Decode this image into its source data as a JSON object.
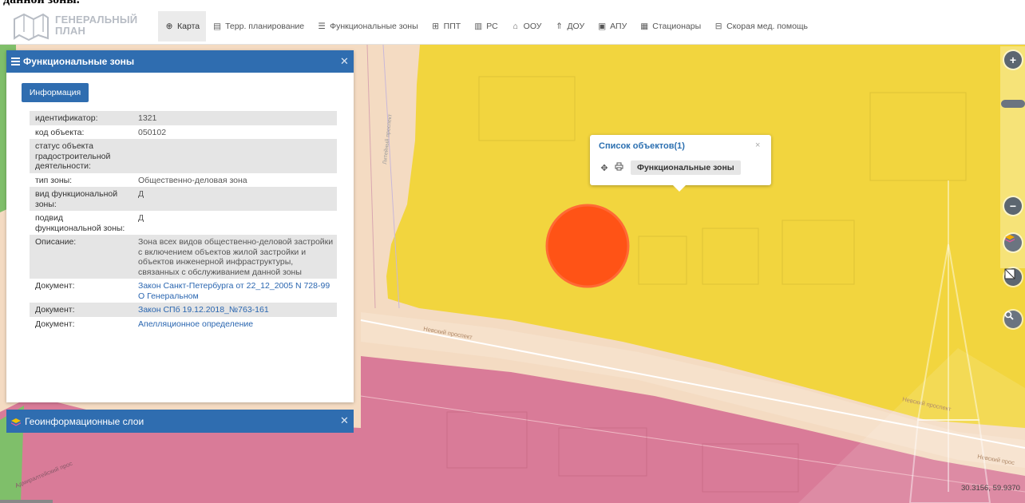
{
  "top_strip_text": "данной зоны.",
  "logo": {
    "line1": "ГЕНЕРАЛЬНЫЙ",
    "line2": "ПЛАН"
  },
  "nav": [
    {
      "label": "Карта",
      "icon": "globe-icon",
      "active": true
    },
    {
      "label": "Терр. планирование",
      "icon": "document-icon",
      "active": false
    },
    {
      "label": "Функциональные зоны",
      "icon": "list-icon",
      "active": false
    },
    {
      "label": "ППТ",
      "icon": "grid-icon",
      "active": false
    },
    {
      "label": "РС",
      "icon": "building-icon",
      "active": false
    },
    {
      "label": "ООУ",
      "icon": "school-icon",
      "active": false
    },
    {
      "label": "ДОУ",
      "icon": "kindergarten-icon",
      "active": false
    },
    {
      "label": "АПУ",
      "icon": "image-icon",
      "active": false
    },
    {
      "label": "Стационары",
      "icon": "hospital-icon",
      "active": false
    },
    {
      "label": "Скорая мед. помощь",
      "icon": "ambulance-icon",
      "active": false
    }
  ],
  "panel": {
    "title": "Функциональные зоны",
    "info_button": "Информация",
    "rows": [
      {
        "key": "идентификатор:",
        "value": "1321",
        "link": false,
        "shade": true
      },
      {
        "key": "код объекта:",
        "value": "050102",
        "link": false,
        "shade": false
      },
      {
        "key": "статус объекта градостроительной деятельности:",
        "value": "",
        "link": false,
        "shade": true
      },
      {
        "key": "тип зоны:",
        "value": "Общественно-деловая зона",
        "link": false,
        "shade": false
      },
      {
        "key": "вид функциональной зоны:",
        "value": "Д",
        "link": false,
        "shade": true
      },
      {
        "key": "подвид функциональной зоны:",
        "value": "Д",
        "link": false,
        "shade": false
      },
      {
        "key": "Описание:",
        "value": "Зона всех видов общественно-деловой застройки с включением объектов жилой застройки и объектов инженерной инфраструктуры, связанных с обслуживанием данной зоны",
        "link": false,
        "shade": true
      },
      {
        "key": "Документ:",
        "value": "Закон Санкт-Петербурга от 22_12_2005 N 728-99 О Генеральном",
        "link": true,
        "shade": false
      },
      {
        "key": "Документ:",
        "value": "Закон СПб 19.12.2018_№763-161",
        "link": true,
        "shade": true
      },
      {
        "key": "Документ:",
        "value": "Апелляционное определение",
        "link": true,
        "shade": false
      }
    ]
  },
  "layers_panel": {
    "title": "Геоинформационные слои"
  },
  "popup": {
    "title": "Список объектов(1)",
    "item": "Функциональные зоны",
    "close": "×"
  },
  "map_labels": {
    "street1": "Невский проспект",
    "street2": "Невский проспект",
    "street3": "Невский прос",
    "street4": "Адмиралтейский прос",
    "street5": "Литейный проспект"
  },
  "controls": {
    "zoom_in": "+",
    "zoom_out": "−"
  },
  "coords": "30.3156, 59.9370",
  "colors": {
    "header_blue": "#2f6db0",
    "zone_yellow": "#f2d53e",
    "zone_pink": "#d97b98",
    "road_peach": "#f4dbc2",
    "marker_orange": "#ff5316"
  }
}
